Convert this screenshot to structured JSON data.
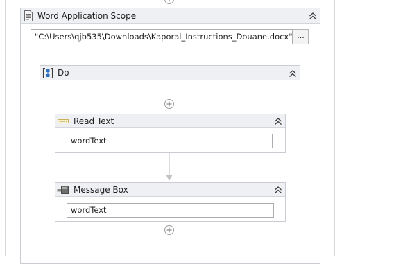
{
  "scope": {
    "title": "Word Application Scope",
    "file_path": "\"C:\\Users\\qjb535\\Downloads\\Kaporal_Instructions_Douane.docx\"",
    "browse_label": "..."
  },
  "sequence": {
    "title": "Do",
    "activities": [
      {
        "title": "Read Text",
        "value": "wordText",
        "icon": "read-text-icon"
      },
      {
        "title": "Message Box",
        "value": "wordText",
        "icon": "message-box-icon"
      }
    ]
  },
  "icons": {
    "scope": "document-icon",
    "sequence": "sequence-icon",
    "collapse": "double-chevron-up-icon",
    "add": "add-activity-icon"
  },
  "colors": {
    "header_bg": "#eef0f3",
    "border": "#c9cdd3",
    "input_border": "#abadb3",
    "sequence_icon_blue": "#2f6fc0"
  }
}
